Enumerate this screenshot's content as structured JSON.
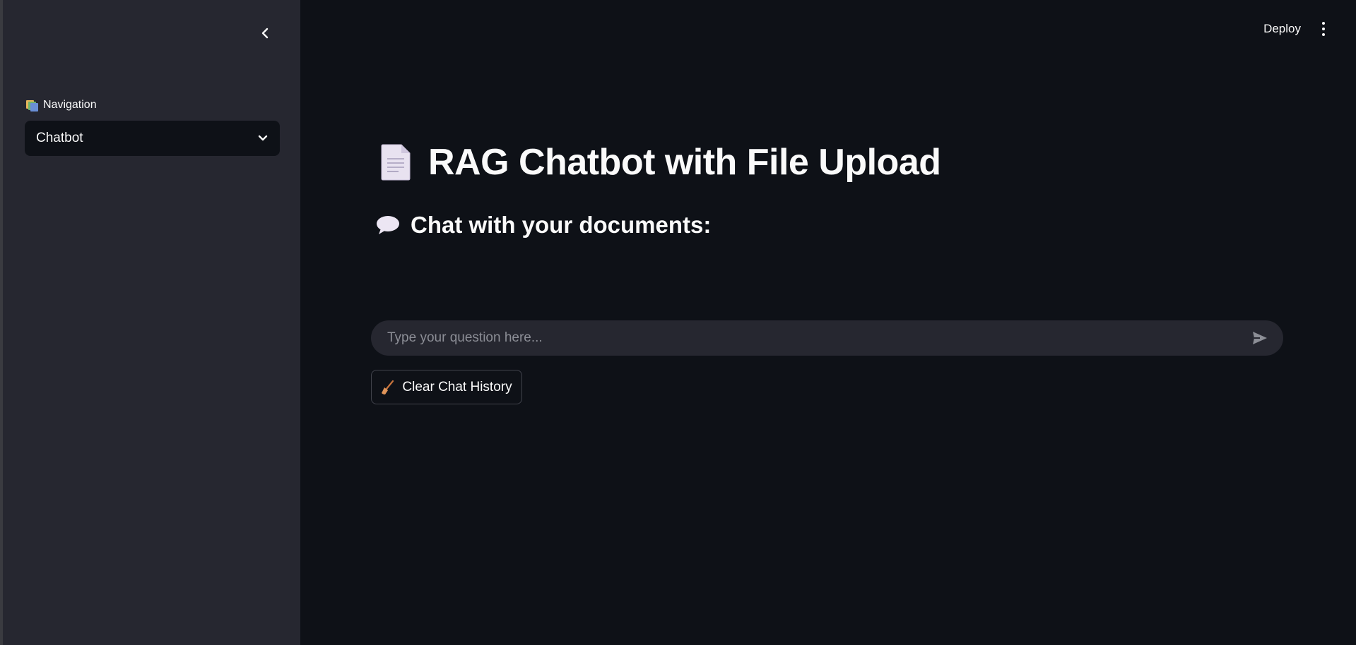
{
  "sidebar": {
    "nav_label": "Navigation",
    "nav_icon": "card-index-dividers-icon",
    "collapse_icon": "chevron-left-icon",
    "select": {
      "value": "Chatbot",
      "icon": "chevron-down-icon"
    }
  },
  "header": {
    "deploy_label": "Deploy",
    "menu_icon": "kebab-menu-icon"
  },
  "main": {
    "title": "RAG Chatbot with File Upload",
    "title_icon": "page-document-icon",
    "subtitle": "Chat with your documents:",
    "subtitle_icon": "speech-balloon-icon",
    "chat_input": {
      "placeholder": "Type your question here...",
      "value": "",
      "send_icon": "send-arrow-icon"
    },
    "clear_button": {
      "label": "Clear Chat History",
      "icon": "broom-icon"
    }
  },
  "colors": {
    "main_bg": "#0e1117",
    "sidebar_bg": "#262730",
    "input_bg": "#262730",
    "text": "#fafafa",
    "placeholder": "#8c8e96",
    "button_border": "#41434c"
  }
}
